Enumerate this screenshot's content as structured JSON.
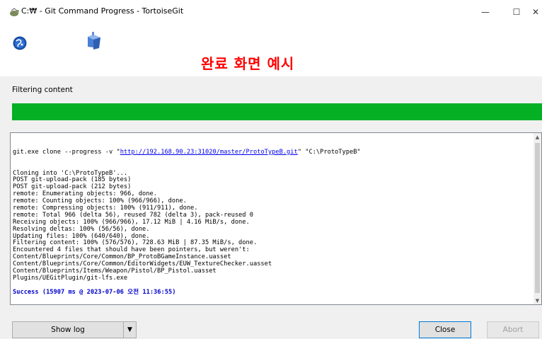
{
  "window": {
    "title": "C:₩ - Git Command Progress - TortoiseGit",
    "controls": {
      "minimize": "—",
      "maximize": "☐",
      "close": "✕"
    }
  },
  "header": {
    "banner": "완료 화면 예시",
    "icons": [
      "globe-icon",
      "folder-icon"
    ]
  },
  "status": {
    "label": "Filtering content",
    "progress": 1.0,
    "progress_color": "#06b025"
  },
  "log": {
    "command_prefix": "git.exe clone --progress -v \"",
    "url": "http://192.168.90.23:31020/master/ProtoTypeB.git",
    "command_suffix": "\" \"C:\\ProtoTypeB\"",
    "lines": [
      "Cloning into 'C:\\ProtoTypeB'...",
      "POST git-upload-pack (185 bytes)",
      "POST git-upload-pack (212 bytes)",
      "remote: Enumerating objects: 966, done.",
      "remote: Counting objects: 100% (966/966), done.",
      "remote: Compressing objects: 100% (911/911), done.",
      "remote: Total 966 (delta 56), reused 782 (delta 3), pack-reused 0",
      "Receiving objects: 100% (966/966), 17.12 MiB | 4.16 MiB/s, done.",
      "Resolving deltas: 100% (56/56), done.",
      "Updating files: 100% (640/640), done.",
      "Filtering content: 100% (576/576), 728.63 MiB | 87.35 MiB/s, done.",
      "Encountered 4 files that should have been pointers, but weren't:",
      "Content/Blueprints/Core/Common/BP_ProtoBGameInstance.uasset",
      "Content/Blueprints/Core/Common/EditorWidgets/EUW_TextureChecker.uasset",
      "Content/Blueprints/Items/Weapon/Pistol/BP_Pistol.uasset",
      "Plugins/UEGitPlugin/git-lfs.exe",
      ""
    ],
    "success": "Success (15907 ms @ 2023-07-06 오전 11:36:55)"
  },
  "buttons": {
    "show_log": "Show log",
    "dropdown": "▼",
    "close": "Close",
    "abort": "Abort"
  },
  "colors": {
    "banner": "#ff0000",
    "progress": "#06b025",
    "link": "#0000ee",
    "success": "#0000cc"
  }
}
